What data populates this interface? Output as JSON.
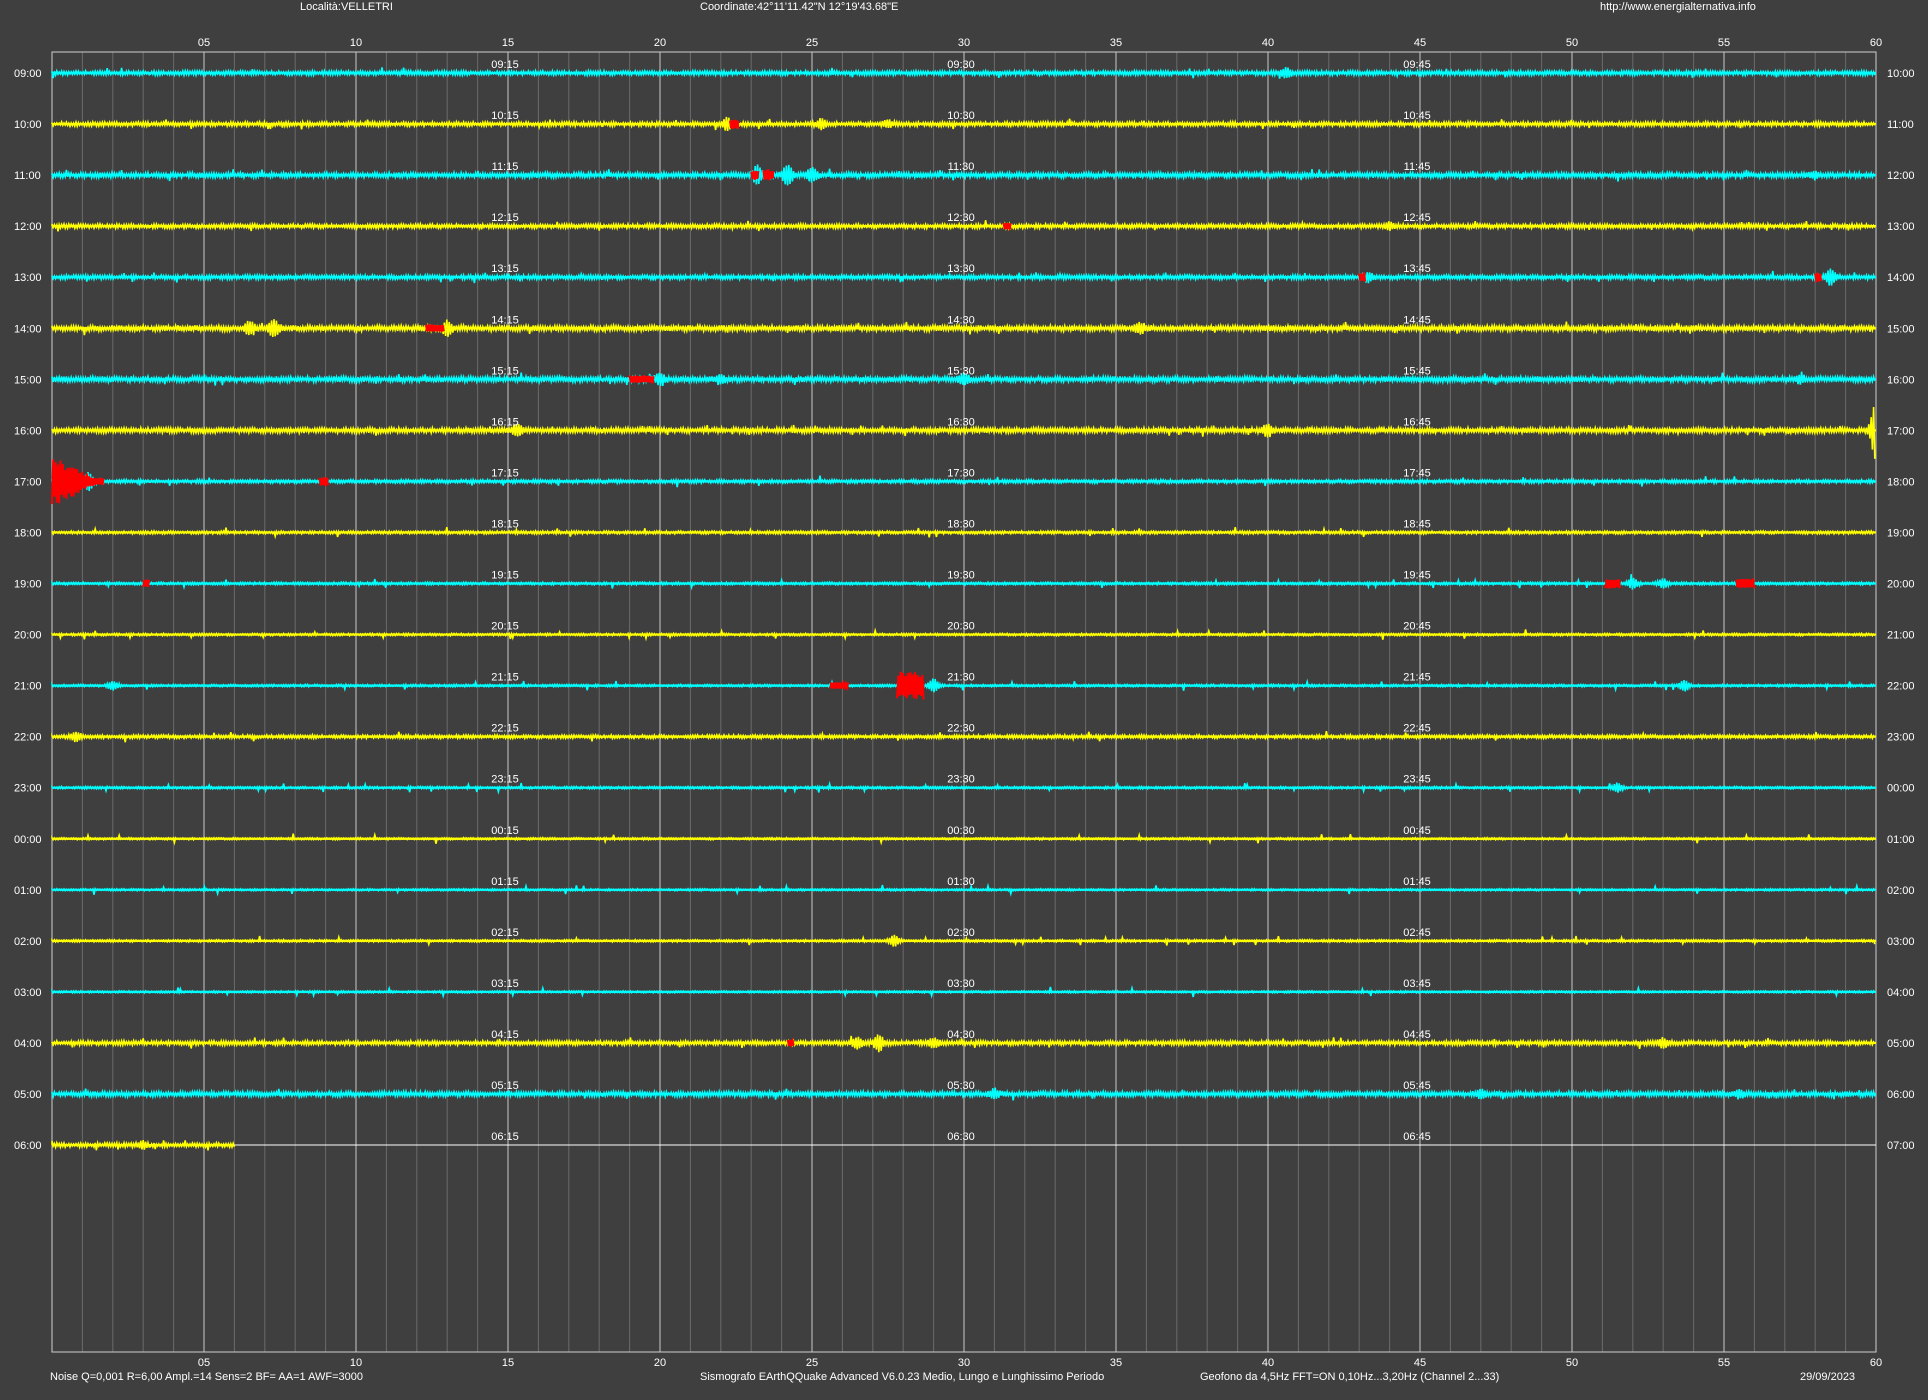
{
  "header": {
    "location": "Località:VELLETRI",
    "coordinates": "Coordinate:42°11'11.42\"N  12°19'43.68\"E",
    "website": "http://www.energialternativa.info"
  },
  "footer": {
    "settings": "Noise Q=0,001 R=6,00 Ampl.=14 Sens=2 BF= AA=1 AWF=3000",
    "software": "Sismografo  EArthQQuake Advanced V6.0.23  Medio, Lungo e Lunghissimo Periodo",
    "sensor": "Geofono da 4,5Hz FFT=ON 0,10Hz...3,20Hz       (Channel 2...33)",
    "date": "29/09/2023"
  },
  "chart_data": {
    "type": "helicorder",
    "x_axis": {
      "unit": "minutes",
      "range": [
        0,
        60
      ],
      "tick_labels": [
        "05",
        "10",
        "15",
        "20",
        "25",
        "30",
        "35",
        "40",
        "45",
        "50",
        "55",
        "60"
      ],
      "minor_tick_every": 1
    },
    "trace_colors": [
      "#00ffff",
      "#ffff00"
    ],
    "event_color": "#ff0000",
    "rows": [
      {
        "start": "09:00",
        "end": "10:00",
        "marks": [
          "09:15",
          "09:30",
          "09:45"
        ],
        "color": "cyan",
        "noise": 1.5,
        "bursts": [
          {
            "min": 40.6,
            "amp": 4
          }
        ],
        "events": []
      },
      {
        "start": "10:00",
        "end": "11:00",
        "marks": [
          "10:15",
          "10:30",
          "10:45"
        ],
        "color": "yellow",
        "noise": 1.5,
        "bursts": [
          {
            "min": 22.2,
            "amp": 5
          },
          {
            "min": 25.3,
            "amp": 4
          },
          {
            "min": 27.5,
            "amp": 3
          }
        ],
        "events": [
          {
            "min": 22.3,
            "len": 0.3,
            "amp": 5
          }
        ]
      },
      {
        "start": "11:00",
        "end": "12:00",
        "marks": [
          "11:15",
          "11:30",
          "11:45"
        ],
        "color": "cyan",
        "noise": 1.8,
        "bursts": [
          {
            "min": 23.2,
            "amp": 8
          },
          {
            "min": 24.2,
            "amp": 9
          },
          {
            "min": 25.0,
            "amp": 6
          },
          {
            "min": 58.0,
            "amp": 3
          }
        ],
        "events": [
          {
            "min": 23.0,
            "len": 0.25,
            "amp": 5
          },
          {
            "min": 23.4,
            "len": 0.35,
            "amp": 6
          }
        ]
      },
      {
        "start": "12:00",
        "end": "13:00",
        "marks": [
          "12:15",
          "12:30",
          "12:45"
        ],
        "color": "yellow",
        "noise": 1.5,
        "bursts": [
          {
            "min": 44,
            "amp": 3
          }
        ],
        "events": [
          {
            "min": 31.3,
            "len": 0.25,
            "amp": 3
          }
        ]
      },
      {
        "start": "13:00",
        "end": "14:00",
        "marks": [
          "13:15",
          "13:30",
          "13:45"
        ],
        "color": "cyan",
        "noise": 1.5,
        "bursts": [
          {
            "min": 43.3,
            "amp": 4
          },
          {
            "min": 58.5,
            "amp": 7
          }
        ],
        "events": [
          {
            "min": 43.0,
            "len": 0.2,
            "amp": 5
          },
          {
            "min": 58.0,
            "len": 0.2,
            "amp": 5
          }
        ]
      },
      {
        "start": "14:00",
        "end": "15:00",
        "marks": [
          "14:15",
          "14:30",
          "14:45"
        ],
        "color": "yellow",
        "noise": 2.0,
        "bursts": [
          {
            "min": 6.5,
            "amp": 5
          },
          {
            "min": 7.3,
            "amp": 7
          },
          {
            "min": 13.0,
            "amp": 6
          },
          {
            "min": 35.8,
            "amp": 4
          }
        ],
        "events": [
          {
            "min": 12.3,
            "len": 0.6,
            "amp": 4
          }
        ]
      },
      {
        "start": "15:00",
        "end": "16:00",
        "marks": [
          "15:15",
          "15:30",
          "15:45"
        ],
        "color": "cyan",
        "noise": 2.0,
        "bursts": [
          {
            "min": 20.0,
            "amp": 5
          },
          {
            "min": 22.0,
            "amp": 4
          },
          {
            "min": 30.0,
            "amp": 4
          },
          {
            "min": 57.5,
            "amp": 3
          }
        ],
        "events": [
          {
            "min": 19.0,
            "len": 0.8,
            "amp": 4
          }
        ]
      },
      {
        "start": "16:00",
        "end": "17:00",
        "marks": [
          "16:15",
          "16:30",
          "16:45"
        ],
        "color": "yellow",
        "noise": 1.8,
        "bursts": [
          {
            "min": 15.3,
            "amp": 5
          },
          {
            "min": 40.0,
            "amp": 5
          },
          {
            "min": 60.0,
            "amp": 28
          }
        ],
        "events": []
      },
      {
        "start": "17:00",
        "end": "18:00",
        "marks": [
          "17:15",
          "17:30",
          "17:45"
        ],
        "color": "cyan",
        "noise": 1.2,
        "bursts": [
          {
            "min": 1.2,
            "amp": 8
          }
        ],
        "events": [
          {
            "min": 0.0,
            "len": 1.7,
            "amp": 26
          },
          {
            "min": 8.8,
            "len": 0.3,
            "amp": 5
          }
        ]
      },
      {
        "start": "18:00",
        "end": "19:00",
        "marks": [
          "18:15",
          "18:30",
          "18:45"
        ],
        "color": "yellow",
        "noise": 1.0,
        "bursts": [],
        "events": []
      },
      {
        "start": "19:00",
        "end": "20:00",
        "marks": [
          "19:15",
          "19:30",
          "19:45"
        ],
        "color": "cyan",
        "noise": 0.9,
        "bursts": [
          {
            "min": 52.0,
            "amp": 5
          },
          {
            "min": 53.0,
            "amp": 4
          }
        ],
        "events": [
          {
            "min": 3.0,
            "len": 0.2,
            "amp": 4
          },
          {
            "min": 51.1,
            "len": 0.5,
            "amp": 5
          },
          {
            "min": 55.4,
            "len": 0.6,
            "amp": 5
          }
        ]
      },
      {
        "start": "20:00",
        "end": "21:00",
        "marks": [
          "20:15",
          "20:30",
          "20:45"
        ],
        "color": "yellow",
        "noise": 0.8,
        "bursts": [],
        "events": []
      },
      {
        "start": "21:00",
        "end": "22:00",
        "marks": [
          "21:15",
          "21:30",
          "21:45"
        ],
        "color": "cyan",
        "noise": 0.8,
        "bursts": [
          {
            "min": 2.0,
            "amp": 4
          },
          {
            "min": 29.0,
            "amp": 6
          },
          {
            "min": 53.7,
            "amp": 5
          }
        ],
        "events": [
          {
            "min": 25.6,
            "len": 0.6,
            "amp": 3
          },
          {
            "min": 27.8,
            "len": 0.9,
            "amp": 14
          }
        ]
      },
      {
        "start": "22:00",
        "end": "23:00",
        "marks": [
          "22:15",
          "22:30",
          "22:45"
        ],
        "color": "yellow",
        "noise": 1.2,
        "bursts": [
          {
            "min": 0.8,
            "amp": 4
          }
        ],
        "events": []
      },
      {
        "start": "23:00",
        "end": "00:00",
        "marks": [
          "23:15",
          "23:30",
          "23:45"
        ],
        "color": "cyan",
        "noise": 0.8,
        "bursts": [
          {
            "min": 51.5,
            "amp": 4
          }
        ],
        "events": []
      },
      {
        "start": "00:00",
        "end": "01:00",
        "marks": [
          "00:15",
          "00:30",
          "00:45"
        ],
        "color": "yellow",
        "noise": 0.7,
        "bursts": [],
        "events": []
      },
      {
        "start": "01:00",
        "end": "02:00",
        "marks": [
          "01:15",
          "01:30",
          "01:45"
        ],
        "color": "cyan",
        "noise": 0.7,
        "bursts": [],
        "events": []
      },
      {
        "start": "02:00",
        "end": "03:00",
        "marks": [
          "02:15",
          "02:30",
          "02:45"
        ],
        "color": "yellow",
        "noise": 0.8,
        "bursts": [
          {
            "min": 27.7,
            "amp": 5
          }
        ],
        "events": []
      },
      {
        "start": "03:00",
        "end": "04:00",
        "marks": [
          "03:15",
          "03:30",
          "03:45"
        ],
        "color": "cyan",
        "noise": 0.7,
        "bursts": [],
        "events": []
      },
      {
        "start": "04:00",
        "end": "05:00",
        "marks": [
          "04:15",
          "04:30",
          "04:45"
        ],
        "color": "yellow",
        "noise": 1.5,
        "bursts": [
          {
            "min": 26.5,
            "amp": 5
          },
          {
            "min": 27.2,
            "amp": 7
          },
          {
            "min": 29.0,
            "amp": 4
          },
          {
            "min": 53.0,
            "amp": 4
          }
        ],
        "events": [
          {
            "min": 24.2,
            "len": 0.2,
            "amp": 3
          }
        ]
      },
      {
        "start": "05:00",
        "end": "06:00",
        "marks": [
          "05:15",
          "05:30",
          "05:45"
        ],
        "color": "cyan",
        "noise": 1.8,
        "bursts": [
          {
            "min": 31.0,
            "amp": 4
          },
          {
            "min": 47.0,
            "amp": 3
          },
          {
            "min": 55.5,
            "amp": 3
          }
        ],
        "events": []
      },
      {
        "start": "06:00",
        "end": "07:00",
        "marks": [
          "06:15",
          "06:30",
          "06:45"
        ],
        "color": "yellow",
        "noise": 1.5,
        "bursts": [
          {
            "min": 3.0,
            "amp": 3
          }
        ],
        "events": [],
        "data_until_min": 6.0
      }
    ]
  }
}
